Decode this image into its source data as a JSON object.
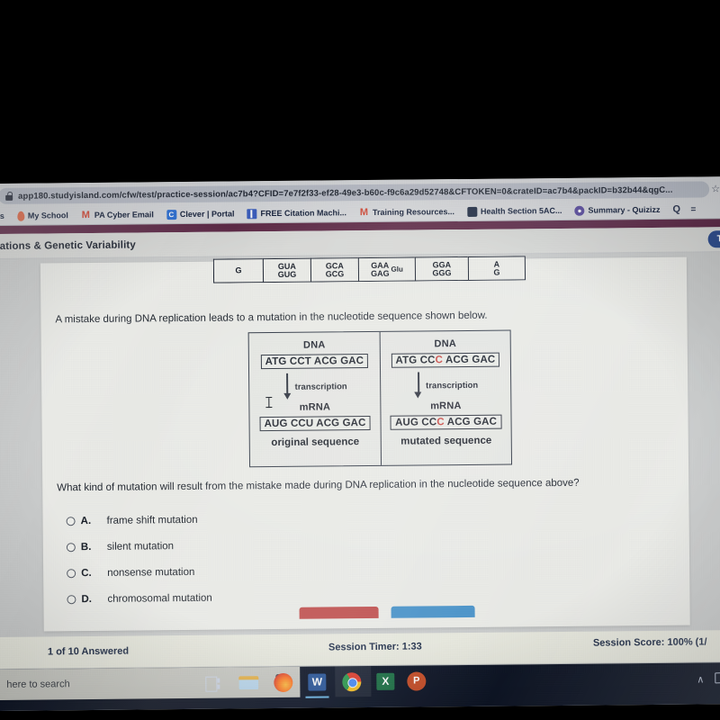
{
  "browser": {
    "url": "app180.studyisland.com/cfw/test/practice-session/ac7b4?CFID=7e7f2f33-ef28-49e3-b60c-f9c6a29d52748&CFTOKEN=0&crateID=ac7b4&packID=b32b44&qgC...",
    "lock_icon": "lock-icon",
    "star_icon": "star-icon",
    "bookmarks": [
      {
        "label": "ns",
        "icon": "partial-bookmark-icon"
      },
      {
        "label": "My School",
        "icon": "pin-icon"
      },
      {
        "label": "PA Cyber Email",
        "icon": "gmail-icon"
      },
      {
        "label": "Clever | Portal",
        "icon": "clever-icon"
      },
      {
        "label": "FREE Citation Machi...",
        "icon": "blue-book-icon"
      },
      {
        "label": "Training Resources...",
        "icon": "gmail-icon"
      },
      {
        "label": "Health Section 5AC...",
        "icon": "dark-square-icon"
      },
      {
        "label": "Summary - Quizizz",
        "icon": "quizizz-icon"
      },
      {
        "label": "Q",
        "icon": "q-icon"
      }
    ],
    "bookmarks_overflow": "="
  },
  "site": {
    "page_title": "utations & Genetic Variability",
    "top_badge": "T"
  },
  "codon_table": [
    {
      "codons": [
        "G"
      ],
      "aa": ""
    },
    {
      "codons": [
        "GUA",
        "GUG"
      ],
      "aa": ""
    },
    {
      "codons": [
        "GCA",
        "GCG"
      ],
      "aa": ""
    },
    {
      "codons": [
        "GAA",
        "GAG"
      ],
      "aa": "Glu"
    },
    {
      "codons": [
        "GGA",
        "GGG"
      ],
      "aa": ""
    },
    {
      "codons": [
        "A",
        "G"
      ],
      "aa": ""
    }
  ],
  "question": {
    "intro": "A mistake during DNA replication leads to a mutation in the nucleotide sequence shown below.",
    "stem": "What kind of mutation will result from the mistake made during DNA replication in the nucleotide sequence above?",
    "options": [
      {
        "letter": "A.",
        "label": "frame shift mutation",
        "selected": false
      },
      {
        "letter": "B.",
        "label": "silent mutation",
        "selected": false
      },
      {
        "letter": "C.",
        "label": "nonsense mutation",
        "selected": false
      },
      {
        "letter": "D.",
        "label": "chromosomal mutation",
        "selected": false
      }
    ]
  },
  "diagram": {
    "panels": [
      {
        "dna_label": "DNA",
        "dna_sequence": "ATG CCT ACG GAC",
        "dna_prefix": "ATG CCT ACG GAC",
        "dna_mutated_base": "",
        "dna_suffix": "",
        "arrow_label": "transcription",
        "mrna_label": "mRNA",
        "mrna_prefix": "AUG CCU ACG GAC",
        "mrna_mutated_base": "",
        "mrna_suffix": "",
        "caption": "original sequence"
      },
      {
        "dna_label": "DNA",
        "dna_sequence": "ATG CCC ACG GAC",
        "dna_prefix": "ATG CC",
        "dna_mutated_base": "C",
        "dna_suffix": " ACG GAC",
        "arrow_label": "transcription",
        "mrna_label": "mRNA",
        "mrna_prefix": "AUG CC",
        "mrna_mutated_base": "C",
        "mrna_suffix": " ACG GAC",
        "caption": "mutated sequence"
      }
    ],
    "mutation_color": "#c8403a"
  },
  "buttons": {
    "reset_label": "",
    "submit_label": "",
    "reset_color": "#c0504d",
    "submit_color": "#4a93c9"
  },
  "footer": {
    "answered": "1 of 10 Answered",
    "timer": "Session Timer: 1:33",
    "score": "Session Score: 100% (1/"
  },
  "taskbar": {
    "search_placeholder": "here to search",
    "mic_icon": "microphone-icon",
    "apps": [
      {
        "name": "task-view",
        "label": "Task View"
      },
      {
        "name": "file-explorer",
        "label": "File Explorer"
      },
      {
        "name": "firefox",
        "label": "Firefox"
      },
      {
        "name": "word",
        "label": "W"
      },
      {
        "name": "chrome",
        "label": "Google Chrome"
      },
      {
        "name": "excel",
        "label": "X"
      },
      {
        "name": "powerpoint",
        "label": "P"
      }
    ],
    "tray_chevron": "∧"
  }
}
